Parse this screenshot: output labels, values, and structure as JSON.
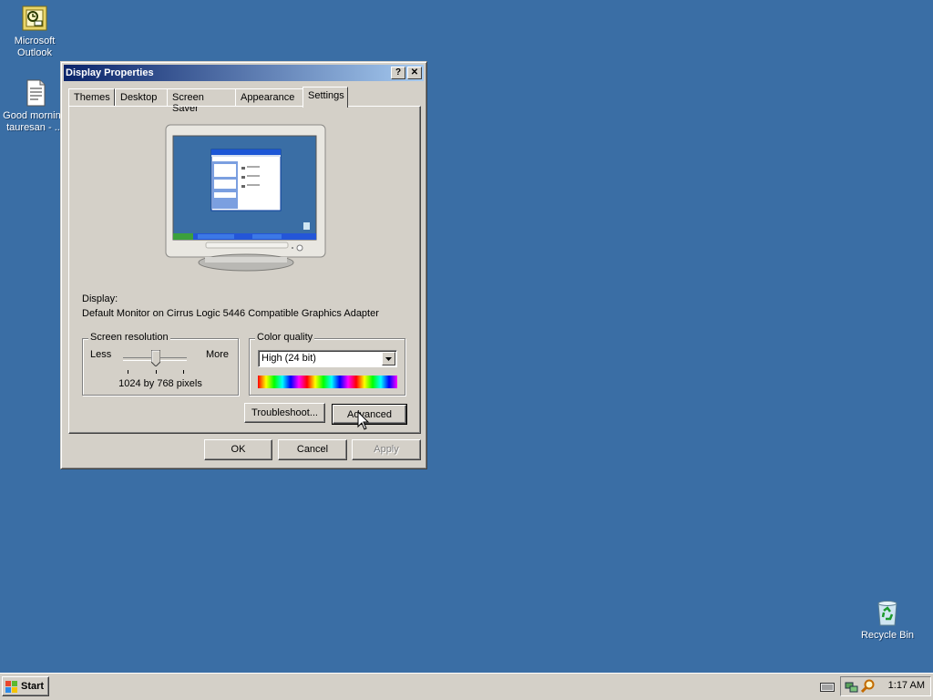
{
  "desktop": {
    "icons": [
      {
        "label_line1": "Microsoft",
        "label_line2": "Outlook"
      },
      {
        "label_line1": "Good morning",
        "label_line2": "tauresan - ..."
      },
      {
        "label_line1": "Recycle Bin",
        "label_line2": ""
      }
    ],
    "background": "#3a6ea5"
  },
  "dialog": {
    "title": "Display Properties",
    "help_label": "?",
    "close_label": "✕",
    "tabs": [
      {
        "label": "Themes"
      },
      {
        "label": "Desktop"
      },
      {
        "label": "Screen Saver"
      },
      {
        "label": "Appearance"
      },
      {
        "label": "Settings",
        "active": true
      }
    ],
    "display_label": "Display:",
    "display_value": "Default Monitor on Cirrus Logic 5446 Compatible Graphics Adapter",
    "resolution": {
      "title": "Screen resolution",
      "less": "Less",
      "more": "More",
      "value_text": "1024 by 768 pixels",
      "slider_level": 0.5
    },
    "color_quality": {
      "title": "Color quality",
      "selected": "High (24 bit)"
    },
    "buttons": {
      "troubleshoot": "Troubleshoot...",
      "advanced": "Advanced",
      "ok": "OK",
      "cancel": "Cancel",
      "apply": "Apply"
    }
  },
  "taskbar": {
    "start_label": "Start",
    "clock": "1:17 AM"
  }
}
